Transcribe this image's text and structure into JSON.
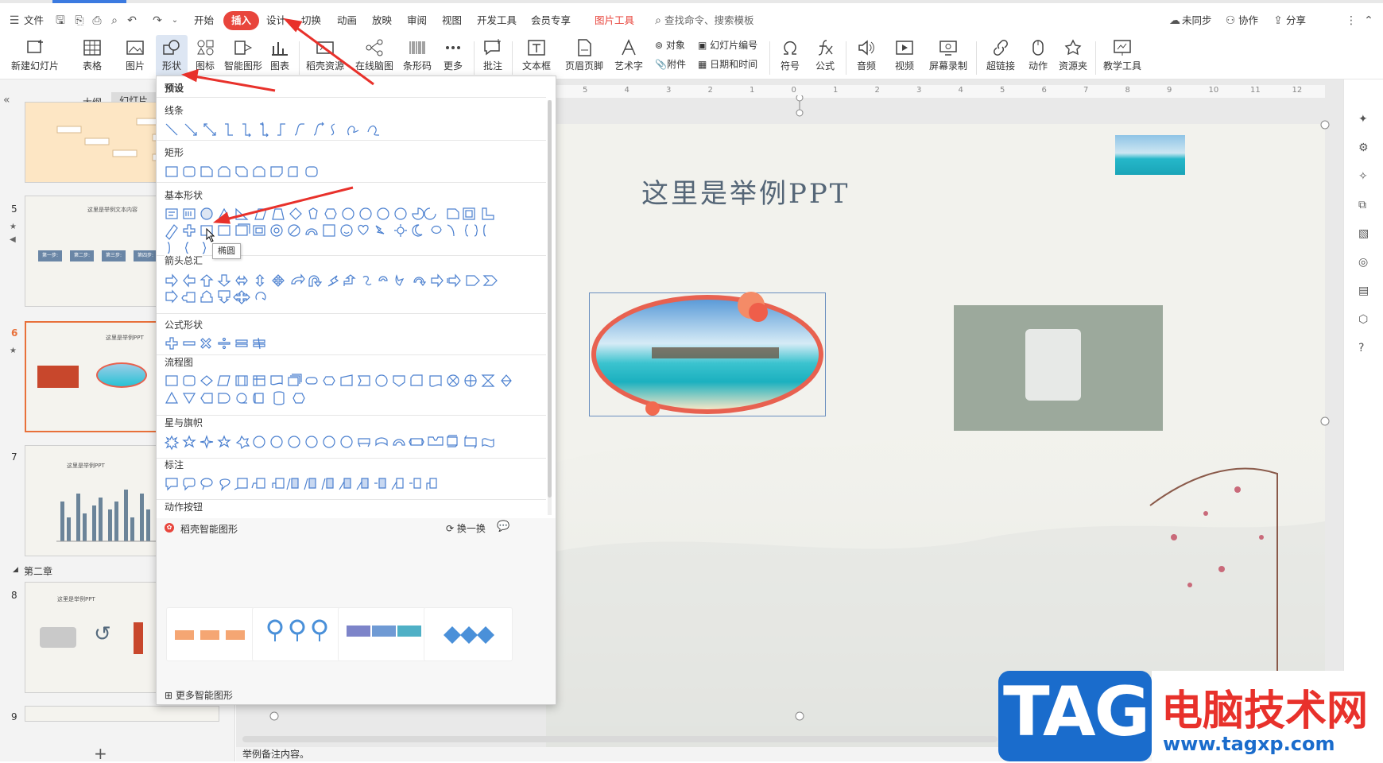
{
  "menubar": {
    "file": "文件",
    "tabs": [
      "开始",
      "插入",
      "设计",
      "切换",
      "动画",
      "放映",
      "审阅",
      "视图",
      "开发工具",
      "会员专享",
      "图片工具"
    ],
    "search_placeholder": "查找命令、搜索模板",
    "sync": "未同步",
    "collab": "协作",
    "share": "分享"
  },
  "toolbar": {
    "new_slide": "新建幻灯片",
    "table": "表格",
    "picture": "图片",
    "shape": "形状",
    "icon": "图标",
    "smart": "智能图形",
    "chart": "图表",
    "daoke": "稻壳资源",
    "mindmap": "在线脑图",
    "barcode": "条形码",
    "more": "更多",
    "comment": "批注",
    "textbox": "文本框",
    "header": "页眉页脚",
    "art": "艺术字",
    "object": "对象",
    "attach": "附件",
    "slide_num": "幻灯片编号",
    "datetime": "日期和时间",
    "symbol": "符号",
    "formula": "公式",
    "audio": "音频",
    "video": "视频",
    "screenrec": "屏幕录制",
    "hyperlink": "超链接",
    "action": "动作",
    "resource": "资源夹",
    "teach": "教学工具"
  },
  "leftpanel": {
    "tab_outline": "大纲",
    "tab_slides": "幻灯片",
    "section2": "第二章",
    "slides": [
      "5",
      "6",
      "7",
      "8",
      "9"
    ],
    "thumb5_title": "这里是举例文本内容",
    "thumb6_title": "这里是举例PPT",
    "thumb7_title": "这里是举例PPT",
    "thumb8_title": "这里是举例PPT",
    "steps": [
      "第一步:",
      "第二步:",
      "第三步:",
      "第四步:"
    ]
  },
  "dropdown": {
    "preset": "预设",
    "sections": [
      "线条",
      "矩形",
      "基本形状",
      "箭头总汇",
      "公式形状",
      "流程图",
      "星与旗帜",
      "标注",
      "动作按钮"
    ],
    "smart_title": "稻壳智能图形",
    "refresh": "换一换",
    "more_smart": "更多智能图形",
    "tooltip": "椭圆"
  },
  "slide": {
    "title": "这里是举例PPT"
  },
  "notes": "举例备注内容。",
  "ruler_labels": [
    "5",
    "4",
    "3",
    "2",
    "1",
    "0",
    "1",
    "2",
    "3",
    "4",
    "5",
    "6",
    "7",
    "8",
    "9",
    "10",
    "11",
    "12"
  ],
  "watermark": {
    "tag": "TAG",
    "site_cn": "电脑技术网",
    "url": "www.tagxp.com"
  },
  "colors": {
    "accent": "#e8453c",
    "selected": "#dde6f3",
    "shape_stroke": "#4a7fcf"
  }
}
